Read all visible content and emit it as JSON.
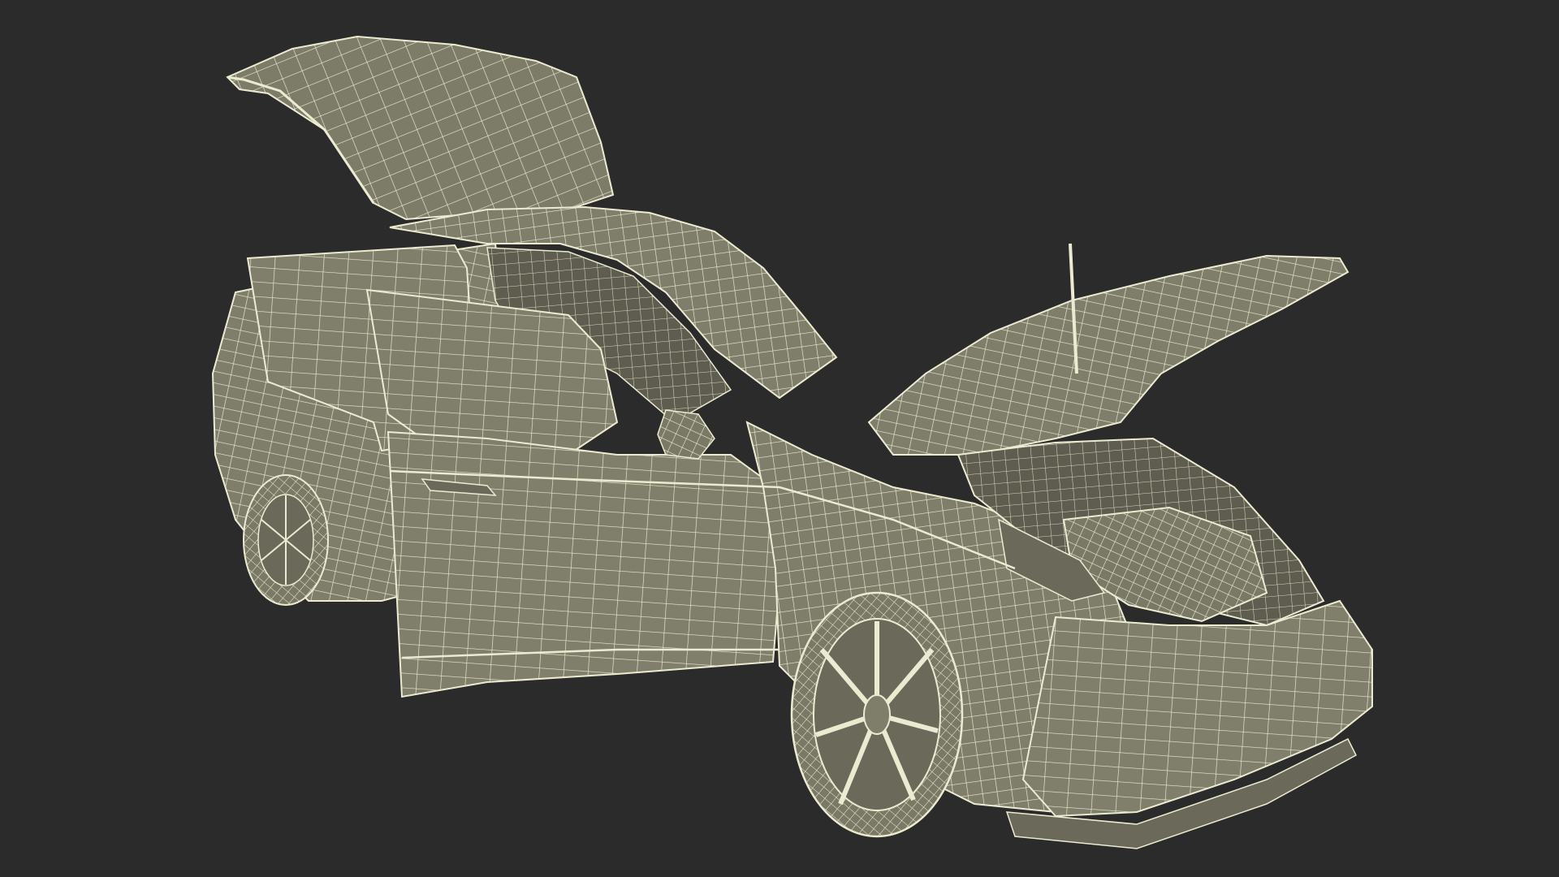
{
  "scene": {
    "subject": "car-wireframe-model",
    "background_color": "#2b2b2b",
    "surface_color": "#7f7e6b",
    "wire_color": "#ecebd2",
    "shadow_color": "#5e5d4f",
    "wheel_dark_color": "#6b6a5a"
  }
}
